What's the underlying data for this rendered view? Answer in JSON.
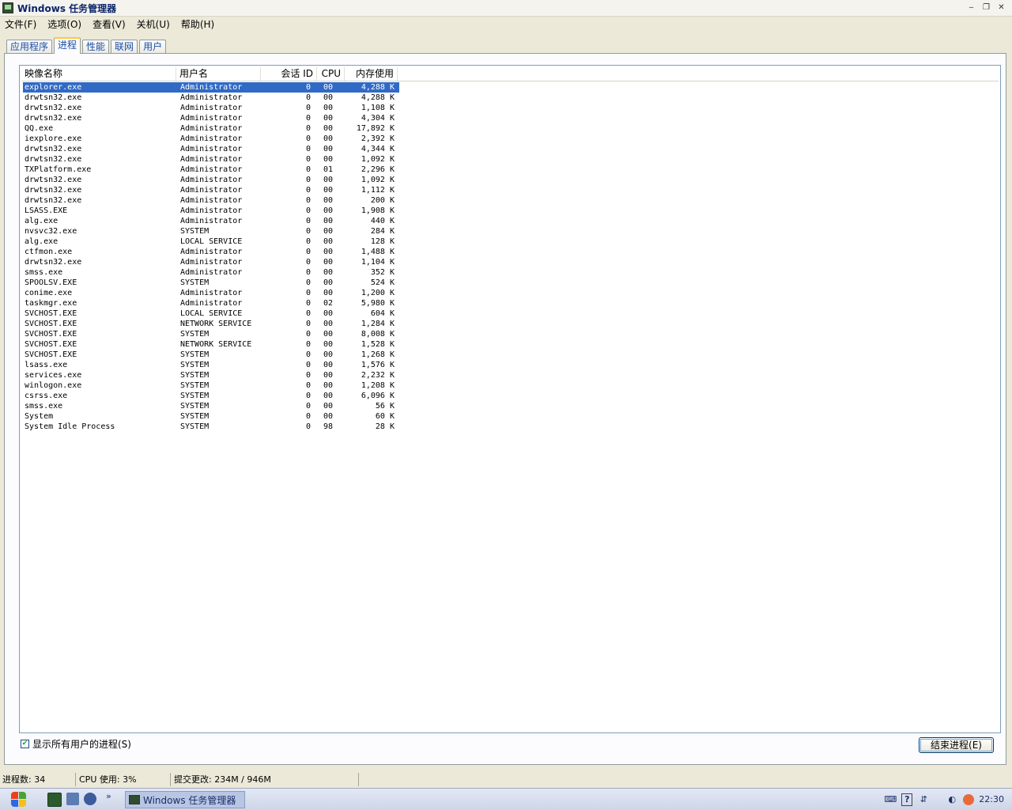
{
  "window": {
    "title": "Windows 任务管理器",
    "minimize_glyph": "‒",
    "restore_glyph": "❐",
    "close_glyph": "✕"
  },
  "menubar": [
    "文件(F)",
    "选项(O)",
    "查看(V)",
    "关机(U)",
    "帮助(H)"
  ],
  "tabs": [
    "应用程序",
    "进程",
    "性能",
    "联网",
    "用户"
  ],
  "active_tab": "进程",
  "columns": {
    "name": "映像名称",
    "user": "用户名",
    "session": "会话 ID",
    "cpu": "CPU",
    "mem": "内存使用"
  },
  "processes": [
    {
      "name": "explorer.exe",
      "user": "Administrator",
      "session": "0",
      "cpu": "00",
      "mem": "4,288 K"
    },
    {
      "name": "drwtsn32.exe",
      "user": "Administrator",
      "session": "0",
      "cpu": "00",
      "mem": "4,288 K"
    },
    {
      "name": "drwtsn32.exe",
      "user": "Administrator",
      "session": "0",
      "cpu": "00",
      "mem": "1,108 K"
    },
    {
      "name": "drwtsn32.exe",
      "user": "Administrator",
      "session": "0",
      "cpu": "00",
      "mem": "4,304 K"
    },
    {
      "name": "QQ.exe",
      "user": "Administrator",
      "session": "0",
      "cpu": "00",
      "mem": "17,892 K"
    },
    {
      "name": "iexplore.exe",
      "user": "Administrator",
      "session": "0",
      "cpu": "00",
      "mem": "2,392 K"
    },
    {
      "name": "drwtsn32.exe",
      "user": "Administrator",
      "session": "0",
      "cpu": "00",
      "mem": "4,344 K"
    },
    {
      "name": "drwtsn32.exe",
      "user": "Administrator",
      "session": "0",
      "cpu": "00",
      "mem": "1,092 K"
    },
    {
      "name": "TXPlatform.exe",
      "user": "Administrator",
      "session": "0",
      "cpu": "01",
      "mem": "2,296 K"
    },
    {
      "name": "drwtsn32.exe",
      "user": "Administrator",
      "session": "0",
      "cpu": "00",
      "mem": "1,092 K"
    },
    {
      "name": "drwtsn32.exe",
      "user": "Administrator",
      "session": "0",
      "cpu": "00",
      "mem": "1,112 K"
    },
    {
      "name": "drwtsn32.exe",
      "user": "Administrator",
      "session": "0",
      "cpu": "00",
      "mem": "200 K"
    },
    {
      "name": "LSASS.EXE",
      "user": "Administrator",
      "session": "0",
      "cpu": "00",
      "mem": "1,908 K"
    },
    {
      "name": "alg.exe",
      "user": "Administrator",
      "session": "0",
      "cpu": "00",
      "mem": "440 K"
    },
    {
      "name": "nvsvc32.exe",
      "user": "SYSTEM",
      "session": "0",
      "cpu": "00",
      "mem": "284 K"
    },
    {
      "name": "alg.exe",
      "user": "LOCAL SERVICE",
      "session": "0",
      "cpu": "00",
      "mem": "128 K"
    },
    {
      "name": "ctfmon.exe",
      "user": "Administrator",
      "session": "0",
      "cpu": "00",
      "mem": "1,488 K"
    },
    {
      "name": "drwtsn32.exe",
      "user": "Administrator",
      "session": "0",
      "cpu": "00",
      "mem": "1,104 K"
    },
    {
      "name": "smss.exe",
      "user": "Administrator",
      "session": "0",
      "cpu": "00",
      "mem": "352 K"
    },
    {
      "name": "SPOOLSV.EXE",
      "user": "SYSTEM",
      "session": "0",
      "cpu": "00",
      "mem": "524 K"
    },
    {
      "name": "conime.exe",
      "user": "Administrator",
      "session": "0",
      "cpu": "00",
      "mem": "1,200 K"
    },
    {
      "name": "taskmgr.exe",
      "user": "Administrator",
      "session": "0",
      "cpu": "02",
      "mem": "5,980 K"
    },
    {
      "name": "SVCHOST.EXE",
      "user": "LOCAL SERVICE",
      "session": "0",
      "cpu": "00",
      "mem": "604 K"
    },
    {
      "name": "SVCHOST.EXE",
      "user": "NETWORK SERVICE",
      "session": "0",
      "cpu": "00",
      "mem": "1,284 K"
    },
    {
      "name": "SVCHOST.EXE",
      "user": "SYSTEM",
      "session": "0",
      "cpu": "00",
      "mem": "8,008 K"
    },
    {
      "name": "SVCHOST.EXE",
      "user": "NETWORK SERVICE",
      "session": "0",
      "cpu": "00",
      "mem": "1,528 K"
    },
    {
      "name": "SVCHOST.EXE",
      "user": "SYSTEM",
      "session": "0",
      "cpu": "00",
      "mem": "1,268 K"
    },
    {
      "name": "lsass.exe",
      "user": "SYSTEM",
      "session": "0",
      "cpu": "00",
      "mem": "1,576 K"
    },
    {
      "name": "services.exe",
      "user": "SYSTEM",
      "session": "0",
      "cpu": "00",
      "mem": "2,232 K"
    },
    {
      "name": "winlogon.exe",
      "user": "SYSTEM",
      "session": "0",
      "cpu": "00",
      "mem": "1,208 K"
    },
    {
      "name": "csrss.exe",
      "user": "SYSTEM",
      "session": "0",
      "cpu": "00",
      "mem": "6,096 K"
    },
    {
      "name": "smss.exe",
      "user": "SYSTEM",
      "session": "0",
      "cpu": "00",
      "mem": "56 K"
    },
    {
      "name": "System",
      "user": "SYSTEM",
      "session": "0",
      "cpu": "00",
      "mem": "60 K"
    },
    {
      "name": "System Idle Process",
      "user": "SYSTEM",
      "session": "0",
      "cpu": "98",
      "mem": "28 K"
    }
  ],
  "selected_process": "explorer.exe",
  "show_all_users": {
    "label": "显示所有用户的进程(S)",
    "checked": true,
    "check_glyph": "✔"
  },
  "end_process_label": "结束进程(E)",
  "status": {
    "process_count": "进程数: 34",
    "cpu_usage": "CPU 使用: 3%",
    "commit_charge": "提交更改: 234M / 946M"
  },
  "taskbar": {
    "task_button_label": "Windows 任务管理器",
    "quicklaunch_more": "»",
    "clock": "22:30"
  },
  "colors": {
    "selection": "#316ac5",
    "tab_highlight": "#ffc83c",
    "xp_red": "#e9411c",
    "xp_green": "#4ca42c",
    "xp_blue": "#2c6ae0",
    "xp_yellow": "#f4c11c"
  }
}
